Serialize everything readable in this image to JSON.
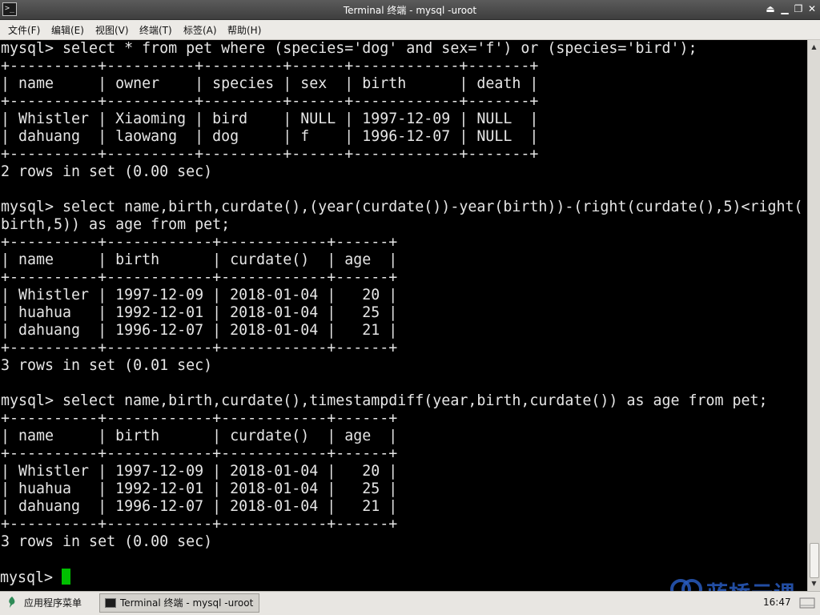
{
  "window": {
    "title": "Terminal 终端 - mysql -uroot",
    "app_icon_glyph": ">_",
    "buttons": {
      "shade": "⏏",
      "minimize": "▁",
      "maximize": "❐",
      "close": "✕"
    }
  },
  "menubar": {
    "items": [
      "文件(F)",
      "编辑(E)",
      "视图(V)",
      "终端(T)",
      "标签(A)",
      "帮助(H)"
    ]
  },
  "terminal": {
    "lines": [
      "mysql> select * from pet where (species='dog' and sex='f') or (species='bird');",
      "+----------+----------+---------+------+------------+-------+",
      "| name     | owner    | species | sex  | birth      | death |",
      "+----------+----------+---------+------+------------+-------+",
      "| Whistler | Xiaoming | bird    | NULL | 1997-12-09 | NULL  |",
      "| dahuang  | laowang  | dog     | f    | 1996-12-07 | NULL  |",
      "+----------+----------+---------+------+------------+-------+",
      "2 rows in set (0.00 sec)",
      "",
      "mysql> select name,birth,curdate(),(year(curdate())-year(birth))-(right(curdate(),5)<right(",
      "birth,5)) as age from pet;",
      "+----------+------------+------------+------+",
      "| name     | birth      | curdate()  | age  |",
      "+----------+------------+------------+------+",
      "| Whistler | 1997-12-09 | 2018-01-04 |   20 |",
      "| huahua   | 1992-12-01 | 2018-01-04 |   25 |",
      "| dahuang  | 1996-12-07 | 2018-01-04 |   21 |",
      "+----------+------------+------------+------+",
      "3 rows in set (0.01 sec)",
      "",
      "mysql> select name,birth,curdate(),timestampdiff(year,birth,curdate()) as age from pet;",
      "+----------+------------+------------+------+",
      "| name     | birth      | curdate()  | age  |",
      "+----------+------------+------------+------+",
      "| Whistler | 1997-12-09 | 2018-01-04 |   20 |",
      "| huahua   | 1992-12-01 | 2018-01-04 |   25 |",
      "| dahuang  | 1996-12-07 | 2018-01-04 |   21 |",
      "+----------+------------+------------+------+",
      "3 rows in set (0.00 sec)",
      ""
    ],
    "prompt": "mysql> ",
    "cursor_color": "#00c000",
    "text_color": "#e6e6e6",
    "background": "#000000"
  },
  "watermark": {
    "text": "蓝桥云课",
    "icon": "lanqiao-logo-icon",
    "color": "#285abe"
  },
  "taskbar": {
    "start_menu_label": "应用程序菜单",
    "start_icon": "app-menu-icon",
    "task_label": "Terminal 终端 - mysql -uroot",
    "task_icon": "terminal-icon",
    "clock": "16:47"
  }
}
